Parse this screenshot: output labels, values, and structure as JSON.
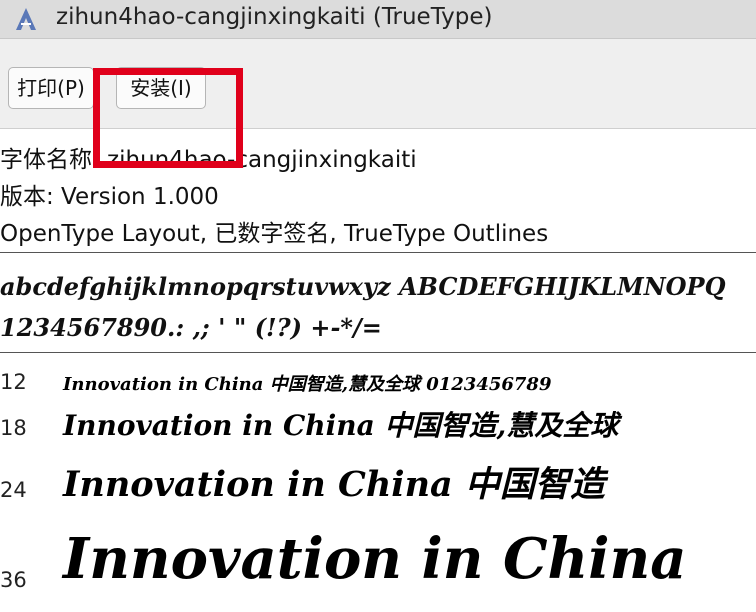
{
  "window": {
    "title": "zihun4hao-cangjinxingkaiti (TrueType)",
    "icon": "font-file-icon"
  },
  "toolbar": {
    "print_label": "打印(P)",
    "install_label": "安装(I)",
    "highlight_color": "#e0001b"
  },
  "info": {
    "font_name": "字体名称: zihun4hao-cangjinxingkaiti",
    "version": "版本: Version 1.000",
    "features": "OpenType Layout, 已数字签名, TrueType Outlines"
  },
  "charset": {
    "letters": "abcdefghijklmnopqrstuvwxyz ABCDEFGHIJKLMNOPQ",
    "digits": "1234567890.: ,; ' \" (!?) +-*/="
  },
  "samples": [
    {
      "size": "12",
      "text": "Innovation in China 中国智造,慧及全球 0123456789"
    },
    {
      "size": "18",
      "text": "Innovation in China 中国智造,慧及全球"
    },
    {
      "size": "24",
      "text": "Innovation in China 中国智造"
    },
    {
      "size": "36",
      "text": "Innovation in China"
    }
  ]
}
